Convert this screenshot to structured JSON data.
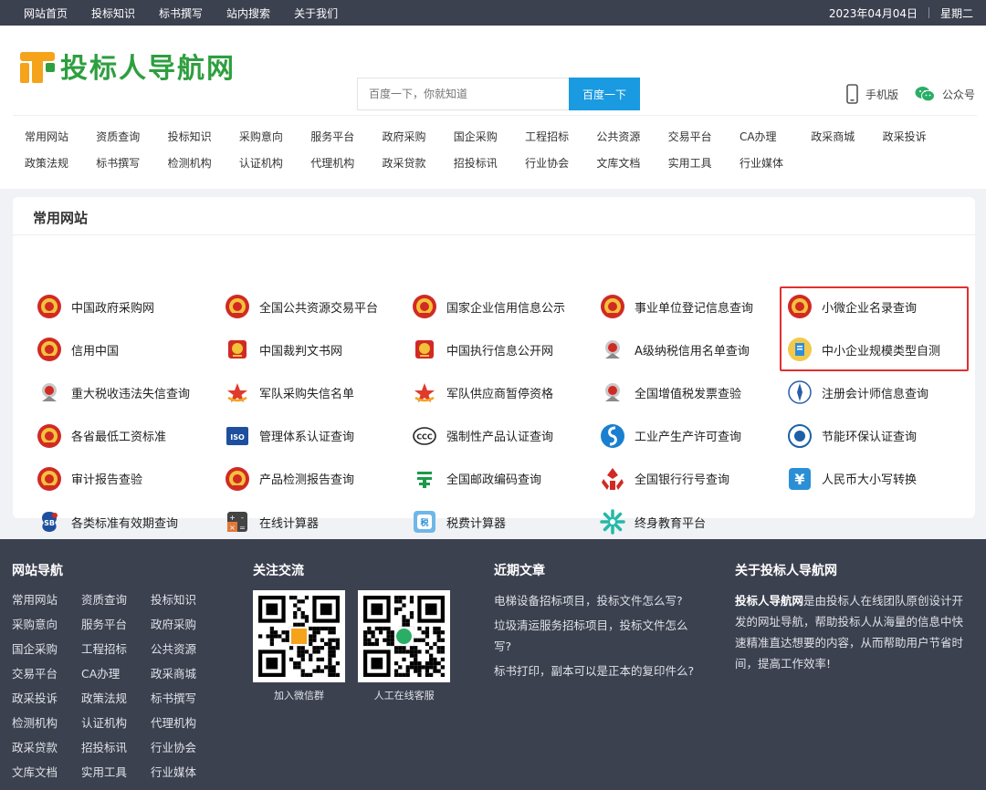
{
  "topbar": {
    "nav": [
      "网站首页",
      "投标知识",
      "标书撰写",
      "站内搜索",
      "关于我们"
    ],
    "date": "2023年04月04日",
    "weekday": "星期二"
  },
  "header": {
    "logo_text": "投标人导航网",
    "search_placeholder": "百度一下，你就知道",
    "search_button": "百度一下",
    "mobile_label": "手机版",
    "wechat_label": "公众号"
  },
  "categories": {
    "row1": [
      "常用网站",
      "资质查询",
      "投标知识",
      "采购意向",
      "服务平台",
      "政府采购",
      "国企采购",
      "工程招标",
      "公共资源",
      "交易平台",
      "CA办理",
      "政采商城",
      "政采投诉"
    ],
    "row2": [
      "政策法规",
      "标书撰写",
      "检测机构",
      "认证机构",
      "代理机构",
      "政采贷款",
      "招投标讯",
      "行业协会",
      "文库文档",
      "实用工具",
      "行业媒体"
    ]
  },
  "main": {
    "title": "常用网站",
    "sites": [
      {
        "label": "中国政府采购网",
        "icon": "emblem-icon"
      },
      {
        "label": "全国公共资源交易平台",
        "icon": "emblem-icon"
      },
      {
        "label": "国家企业信用信息公示",
        "icon": "emblem-icon"
      },
      {
        "label": "事业单位登记信息查询",
        "icon": "emblem-icon"
      },
      {
        "label": "小微企业名录查询",
        "icon": "emblem-icon"
      },
      {
        "label": "信用中国",
        "icon": "emblem-icon"
      },
      {
        "label": "中国裁判文书网",
        "icon": "court-icon"
      },
      {
        "label": "中国执行信息公开网",
        "icon": "court-icon"
      },
      {
        "label": "A级纳税信用名单查询",
        "icon": "tax-icon"
      },
      {
        "label": "中小企业规模类型自测",
        "icon": "document-icon"
      },
      {
        "label": "重大税收违法失信查询",
        "icon": "tax-icon"
      },
      {
        "label": "军队采购失信名单",
        "icon": "star-icon"
      },
      {
        "label": "军队供应商暂停资格",
        "icon": "star-icon"
      },
      {
        "label": "全国增值税发票查验",
        "icon": "tax-icon"
      },
      {
        "label": "注册会计师信息查询",
        "icon": "cpa-icon"
      },
      {
        "label": "各省最低工资标准",
        "icon": "emblem-icon"
      },
      {
        "label": "管理体系认证查询",
        "icon": "iso-icon"
      },
      {
        "label": "强制性产品认证查询",
        "icon": "ccc-icon"
      },
      {
        "label": "工业产生产许可查询",
        "icon": "license-icon"
      },
      {
        "label": "节能环保认证查询",
        "icon": "eco-icon"
      },
      {
        "label": "审计报告查验",
        "icon": "emblem-icon"
      },
      {
        "label": "产品检测报告查询",
        "icon": "emblem-icon"
      },
      {
        "label": "全国邮政编码查询",
        "icon": "post-icon"
      },
      {
        "label": "全国银行行号查询",
        "icon": "bank-icon"
      },
      {
        "label": "人民币大小写转换",
        "icon": "yuan-icon"
      },
      {
        "label": "各类标准有效期查询",
        "icon": "standard-icon"
      },
      {
        "label": "在线计算器",
        "icon": "calculator-icon"
      },
      {
        "label": "税费计算器",
        "icon": "tax-calc-icon"
      },
      {
        "label": "终身教育平台",
        "icon": "education-icon"
      }
    ]
  },
  "footer": {
    "nav_title": "网站导航",
    "nav_items": [
      "常用网站",
      "资质查询",
      "投标知识",
      "采购意向",
      "服务平台",
      "政府采购",
      "国企采购",
      "工程招标",
      "公共资源",
      "交易平台",
      "CA办理",
      "政采商城",
      "政采投诉",
      "政策法规",
      "标书撰写",
      "检测机构",
      "认证机构",
      "代理机构",
      "政采贷款",
      "招投标讯",
      "行业协会",
      "文库文档",
      "实用工具",
      "行业媒体"
    ],
    "follow_title": "关注交流",
    "qr1_caption": "加入微信群",
    "qr2_caption": "人工在线客服",
    "articles_title": "近期文章",
    "articles": [
      "电梯设备招标项目，投标文件怎么写?",
      "垃圾清运服务招标项目，投标文件怎么写?",
      "标书打印，副本可以是正本的复印件么?"
    ],
    "about_title": "关于投标人导航网",
    "about_bold": "投标人导航网",
    "about_text": "是由投标人在线团队原创设计开发的网址导航，帮助投标人从海量的信息中快速精准直达想要的内容，从而帮助用户节省时间，提高工作效率!"
  },
  "colors": {
    "topbar": "#3c4150",
    "accent": "#1a9ae0",
    "logo_green": "#2e9f3f",
    "logo_orange": "#f5a31a",
    "highlight": "#e03030"
  }
}
